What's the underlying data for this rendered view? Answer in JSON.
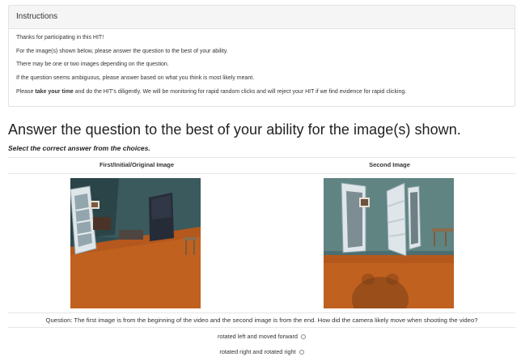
{
  "instructions": {
    "heading": "Instructions",
    "line1": "Thanks for participating in this HIT!",
    "line2": "For the image(s) shown below, please answer the question to the best of your ability.",
    "line3": "There may be one or two images depending on the question.",
    "line4": "If the question seems ambiguous, please answer based on what you think is most likely meant.",
    "line5_prefix": "Please ",
    "line5_bold": "take your time",
    "line5_suffix": " and do the HIT's diligently. We will be monitoring for rapid random clicks and will reject your HIT if we find evidence for rapid clicking."
  },
  "main": {
    "title": "Answer the question to the best of your ability for the image(s) shown.",
    "subtitle": "Select the correct answer from the choices."
  },
  "images": {
    "first_label": "First/Initial/Original Image",
    "second_label": "Second Image"
  },
  "question": "Question: The first image is from the beginning of the video and the second image is from the end. How did the camera likely move when shooting the video?",
  "choices": [
    {
      "label": "rotated left and moved forward",
      "selected": false
    },
    {
      "label": "rotated right and rotated right",
      "selected": false
    }
  ]
}
